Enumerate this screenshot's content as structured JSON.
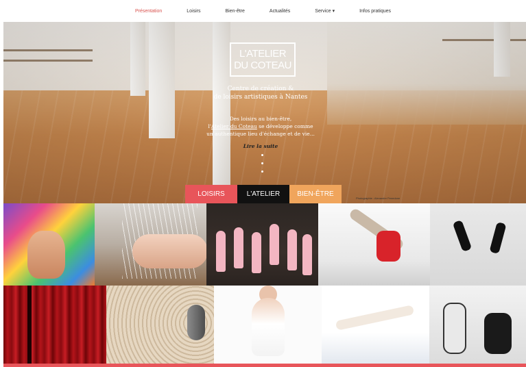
{
  "nav": {
    "items": [
      {
        "label": "Présentation",
        "active": true
      },
      {
        "label": "Loisirs"
      },
      {
        "label": "Bien-être"
      },
      {
        "label": "Actualités"
      },
      {
        "label": "Service ▾"
      },
      {
        "label": "Infos pratiques"
      }
    ]
  },
  "hero": {
    "logo_line1": "L'ATELIER",
    "logo_line2": "DU COTEAU",
    "tagline_line1": "Centre de création &",
    "tagline_line2": "de loisirs artistiques à Nantes",
    "intro_line1": "Des loisirs au bien-être,",
    "intro_line2_pre": "l'",
    "intro_line2_link": "Atelier du Coteau",
    "intro_line2_post": " se développe comme",
    "intro_line3": "un authentique lieu d'échange et de vie...",
    "readmore": "Lire la suite",
    "credit": "Photographie : Alexandre Penedone"
  },
  "tabs": {
    "loisirs": "LOISIRS",
    "atelier": "L'ATELIER",
    "bienetre": "BIEN-ÊTRE"
  },
  "colors": {
    "accent": "#e8555a",
    "dark": "#111111",
    "orange": "#f0a55c",
    "nav_active": "#d9534f"
  },
  "grid": {
    "tiles": [
      {
        "name": "painting-tile",
        "icon": "painting-hand"
      },
      {
        "name": "harp-tile",
        "icon": "harp-baby"
      },
      {
        "name": "ballet-tile",
        "icon": "ballet-girls"
      },
      {
        "name": "breakdance-tile",
        "icon": "dancer"
      },
      {
        "name": "jump-dancers-tile",
        "icon": "dancers"
      },
      {
        "name": "theatre-curtain-tile",
        "icon": "curtain"
      },
      {
        "name": "zen-garden-tile",
        "icon": "zen-stone"
      },
      {
        "name": "yoga-tile",
        "icon": "yoga-pose"
      },
      {
        "name": "stretch-tile",
        "icon": "stretch-pose"
      },
      {
        "name": "martial-arts-tile",
        "icon": "martial-arts"
      }
    ]
  }
}
